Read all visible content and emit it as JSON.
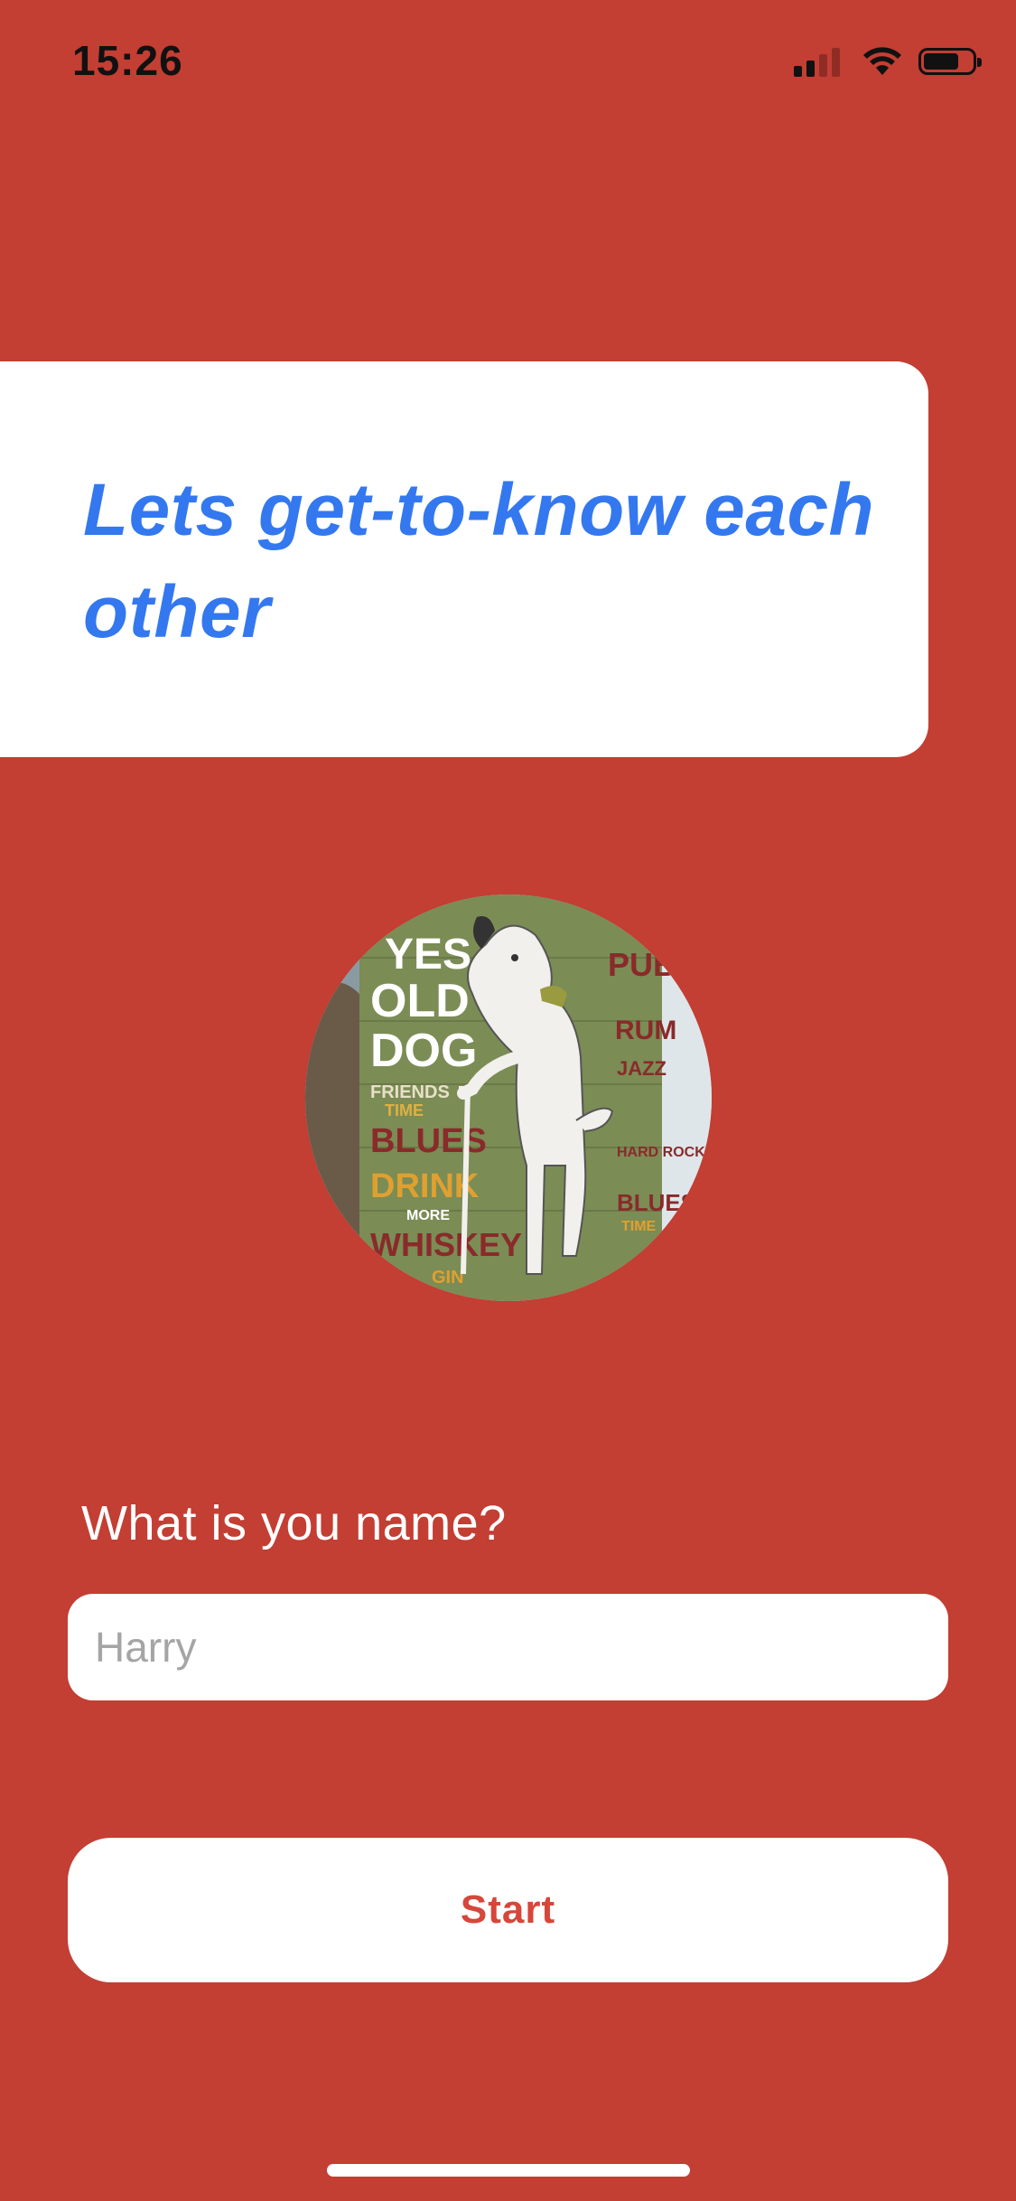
{
  "status_bar": {
    "time": "15:26",
    "icons": [
      "cellular-signal-icon",
      "wifi-icon",
      "battery-icon"
    ]
  },
  "header": {
    "title": "Lets get-to-know each other"
  },
  "avatar": {
    "description_icon": "dog-mural-photo",
    "mural_text": {
      "yes": "YES",
      "old": "OLD",
      "dog": "DOG",
      "friends": "FRIENDS",
      "time": "TIME",
      "blues": "BLUES",
      "drink": "DRINK",
      "more": "MORE",
      "whiskey": "WHISKEY",
      "gin": "GIN",
      "pub": "PUB",
      "rum": "RUM",
      "jazz": "JAZZ",
      "hard_rock": "HARD ROCK",
      "blues2": "BLUES",
      "time2": "TIME"
    }
  },
  "form": {
    "name_label": "What is you name?",
    "name_placeholder": "Harry",
    "name_value": ""
  },
  "actions": {
    "start_label": "Start"
  },
  "colors": {
    "background": "#c33e33",
    "title": "#3478f0",
    "button_text": "#d7463a",
    "card": "#ffffff"
  }
}
